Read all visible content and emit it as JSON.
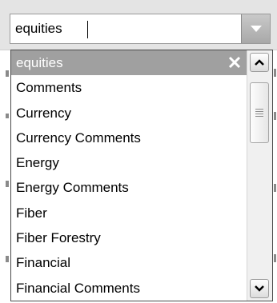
{
  "combo": {
    "value": "equities",
    "arrow_icon": "chevron-down-icon"
  },
  "dropdown": {
    "items": [
      {
        "label": "equities",
        "selected": true
      },
      {
        "label": "Comments"
      },
      {
        "label": "Currency"
      },
      {
        "label": "Currency Comments"
      },
      {
        "label": "Energy"
      },
      {
        "label": "Energy Comments"
      },
      {
        "label": "Fiber"
      },
      {
        "label": "Fiber Forestry"
      },
      {
        "label": "Financial"
      },
      {
        "label": "Financial Comments"
      }
    ],
    "clear_icon": "close-icon"
  },
  "colors": {
    "selected_bg": "#a0a0a0",
    "selected_text": "#ffffff",
    "panel_bg": "#e4e4e4"
  }
}
